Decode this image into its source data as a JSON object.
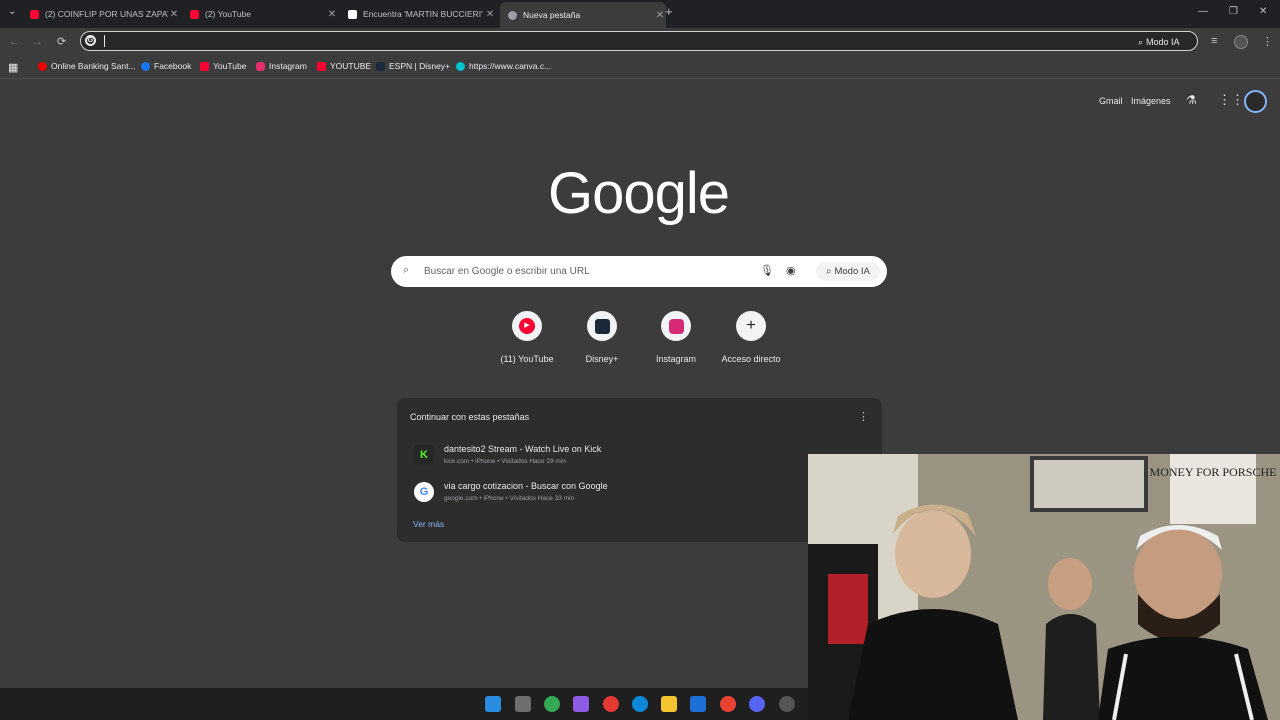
{
  "tabs": [
    {
      "title": "(2) COINFLIP POR UNAS ZAPAT",
      "icon": "youtube-icon",
      "color": "#ff0033"
    },
    {
      "title": "(2) YouTube",
      "icon": "youtube-icon",
      "color": "#ff0033"
    },
    {
      "title": "Encuentra 'MARTIN BUCCIERI' ·",
      "icon": "tiktok-icon",
      "color": "#ffffff"
    },
    {
      "title": "Nueva pestaña",
      "icon": "chrome-icon",
      "color": "#9aa0a6"
    }
  ],
  "omnibox": {
    "modo_ia": "Modo IA"
  },
  "bookmarks": [
    {
      "label": "Online Banking Sant...",
      "color": "#ec0000"
    },
    {
      "label": "Facebook",
      "color": "#1877f2"
    },
    {
      "label": "YouTube",
      "color": "#ff0033"
    },
    {
      "label": "Instagram",
      "color": "#e1306c"
    },
    {
      "label": "YOUTUBE",
      "color": "#ff0033"
    },
    {
      "label": "ESPN | Disney+",
      "color": "#1b2a3a"
    },
    {
      "label": "https://www.canva.c...",
      "color": "#00c4cc"
    }
  ],
  "header": {
    "gmail": "Gmail",
    "images": "Imágenes"
  },
  "google_logo": "Google",
  "search": {
    "placeholder": "Buscar en Google o escribir una URL",
    "modo_ia": "Modo IA"
  },
  "shortcuts": [
    {
      "label": "(11) YouTube"
    },
    {
      "label": "Disney+"
    },
    {
      "label": "Instagram"
    },
    {
      "label": "Acceso directo"
    }
  ],
  "continue_panel": {
    "title": "Continuar con estas pestañas",
    "items": [
      {
        "title": "dantesito2 Stream - Watch Live on Kick",
        "subtitle": "kick.com • iPhone • Visitados Hace 29 min"
      },
      {
        "title": "via cargo cotizacion - Buscar con Google",
        "subtitle": "google.com • iPhone • Visitados Hace 33 min"
      }
    ],
    "more": "Ver más"
  },
  "webcam_sign": "MONEY FOR PORSCHE"
}
